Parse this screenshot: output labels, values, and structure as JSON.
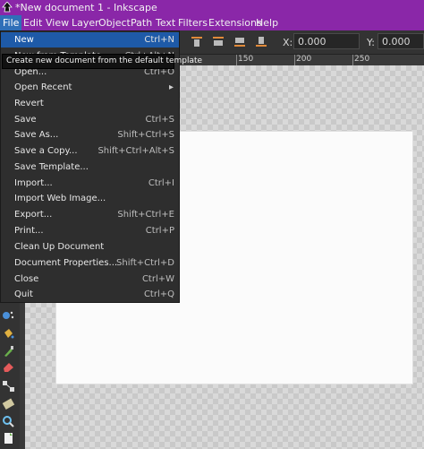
{
  "window": {
    "title": "*New document 1 - Inkscape"
  },
  "menubar": {
    "items": [
      "File",
      "Edit",
      "View",
      "Layer",
      "Object",
      "Path",
      "Text",
      "Filters",
      "Extensions",
      "Help"
    ]
  },
  "toolbar": {
    "x_label": "X:",
    "x_value": "0.000",
    "y_label": "Y:",
    "y_value": "0.000"
  },
  "ruler": {
    "ticks": [
      "150",
      "200",
      "250"
    ]
  },
  "file_menu": {
    "items": [
      {
        "label": "New",
        "shortcut": "Ctrl+N"
      },
      {
        "label": "New from Template...",
        "shortcut": "Ctrl+Alt+N"
      },
      {
        "label": "Open...",
        "shortcut": "Ctrl+O"
      },
      {
        "label": "Open Recent",
        "shortcut": ""
      },
      {
        "label": "Revert",
        "shortcut": ""
      },
      {
        "label": "Save",
        "shortcut": "Ctrl+S"
      },
      {
        "label": "Save As...",
        "shortcut": "Shift+Ctrl+S"
      },
      {
        "label": "Save a Copy...",
        "shortcut": "Shift+Ctrl+Alt+S"
      },
      {
        "label": "Save Template...",
        "shortcut": ""
      },
      {
        "label": "Import...",
        "shortcut": "Ctrl+I"
      },
      {
        "label": "Import Web Image...",
        "shortcut": ""
      },
      {
        "label": "Export...",
        "shortcut": "Shift+Ctrl+E"
      },
      {
        "label": "Print...",
        "shortcut": "Ctrl+P"
      },
      {
        "label": "Clean Up Document",
        "shortcut": ""
      },
      {
        "label": "Document Properties...",
        "shortcut": "Shift+Ctrl+D"
      },
      {
        "label": "Close",
        "shortcut": "Ctrl+W"
      },
      {
        "label": "Quit",
        "shortcut": "Ctrl+Q"
      }
    ],
    "submenu_arrow": "▸"
  },
  "tooltip": {
    "text": "Create new document from the default template"
  },
  "colors": {
    "titlebar": "#8a27a8",
    "highlight": "#1e5aa8",
    "menu_bg": "#2e2e2e"
  }
}
